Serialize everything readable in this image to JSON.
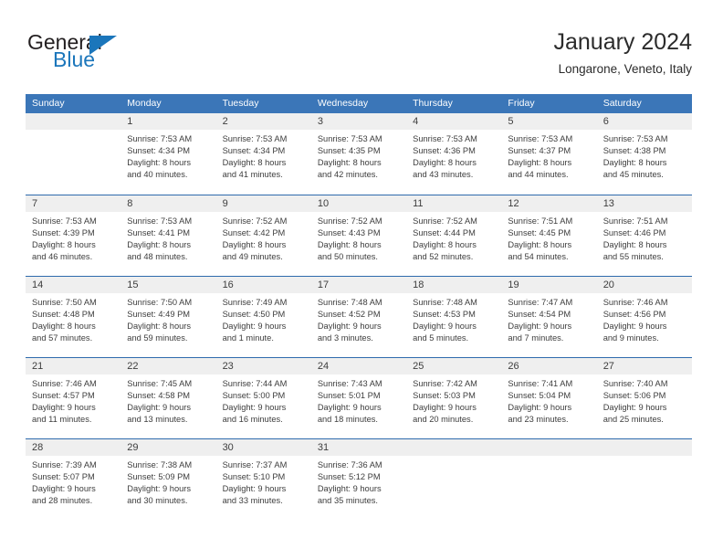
{
  "brand": {
    "name_part1": "General",
    "name_part2": "Blue",
    "accent_color": "#1b76bb"
  },
  "header": {
    "title": "January 2024",
    "subtitle": "Longarone, Veneto, Italy"
  },
  "calendar": {
    "header_color": "#3b76b8",
    "day_band_color": "#efefef",
    "weekdays": [
      "Sunday",
      "Monday",
      "Tuesday",
      "Wednesday",
      "Thursday",
      "Friday",
      "Saturday"
    ],
    "weeks": [
      [
        {
          "day": "",
          "lines": []
        },
        {
          "day": "1",
          "lines": [
            "Sunrise: 7:53 AM",
            "Sunset: 4:34 PM",
            "Daylight: 8 hours",
            "and 40 minutes."
          ]
        },
        {
          "day": "2",
          "lines": [
            "Sunrise: 7:53 AM",
            "Sunset: 4:34 PM",
            "Daylight: 8 hours",
            "and 41 minutes."
          ]
        },
        {
          "day": "3",
          "lines": [
            "Sunrise: 7:53 AM",
            "Sunset: 4:35 PM",
            "Daylight: 8 hours",
            "and 42 minutes."
          ]
        },
        {
          "day": "4",
          "lines": [
            "Sunrise: 7:53 AM",
            "Sunset: 4:36 PM",
            "Daylight: 8 hours",
            "and 43 minutes."
          ]
        },
        {
          "day": "5",
          "lines": [
            "Sunrise: 7:53 AM",
            "Sunset: 4:37 PM",
            "Daylight: 8 hours",
            "and 44 minutes."
          ]
        },
        {
          "day": "6",
          "lines": [
            "Sunrise: 7:53 AM",
            "Sunset: 4:38 PM",
            "Daylight: 8 hours",
            "and 45 minutes."
          ]
        }
      ],
      [
        {
          "day": "7",
          "lines": [
            "Sunrise: 7:53 AM",
            "Sunset: 4:39 PM",
            "Daylight: 8 hours",
            "and 46 minutes."
          ]
        },
        {
          "day": "8",
          "lines": [
            "Sunrise: 7:53 AM",
            "Sunset: 4:41 PM",
            "Daylight: 8 hours",
            "and 48 minutes."
          ]
        },
        {
          "day": "9",
          "lines": [
            "Sunrise: 7:52 AM",
            "Sunset: 4:42 PM",
            "Daylight: 8 hours",
            "and 49 minutes."
          ]
        },
        {
          "day": "10",
          "lines": [
            "Sunrise: 7:52 AM",
            "Sunset: 4:43 PM",
            "Daylight: 8 hours",
            "and 50 minutes."
          ]
        },
        {
          "day": "11",
          "lines": [
            "Sunrise: 7:52 AM",
            "Sunset: 4:44 PM",
            "Daylight: 8 hours",
            "and 52 minutes."
          ]
        },
        {
          "day": "12",
          "lines": [
            "Sunrise: 7:51 AM",
            "Sunset: 4:45 PM",
            "Daylight: 8 hours",
            "and 54 minutes."
          ]
        },
        {
          "day": "13",
          "lines": [
            "Sunrise: 7:51 AM",
            "Sunset: 4:46 PM",
            "Daylight: 8 hours",
            "and 55 minutes."
          ]
        }
      ],
      [
        {
          "day": "14",
          "lines": [
            "Sunrise: 7:50 AM",
            "Sunset: 4:48 PM",
            "Daylight: 8 hours",
            "and 57 minutes."
          ]
        },
        {
          "day": "15",
          "lines": [
            "Sunrise: 7:50 AM",
            "Sunset: 4:49 PM",
            "Daylight: 8 hours",
            "and 59 minutes."
          ]
        },
        {
          "day": "16",
          "lines": [
            "Sunrise: 7:49 AM",
            "Sunset: 4:50 PM",
            "Daylight: 9 hours",
            "and 1 minute."
          ]
        },
        {
          "day": "17",
          "lines": [
            "Sunrise: 7:48 AM",
            "Sunset: 4:52 PM",
            "Daylight: 9 hours",
            "and 3 minutes."
          ]
        },
        {
          "day": "18",
          "lines": [
            "Sunrise: 7:48 AM",
            "Sunset: 4:53 PM",
            "Daylight: 9 hours",
            "and 5 minutes."
          ]
        },
        {
          "day": "19",
          "lines": [
            "Sunrise: 7:47 AM",
            "Sunset: 4:54 PM",
            "Daylight: 9 hours",
            "and 7 minutes."
          ]
        },
        {
          "day": "20",
          "lines": [
            "Sunrise: 7:46 AM",
            "Sunset: 4:56 PM",
            "Daylight: 9 hours",
            "and 9 minutes."
          ]
        }
      ],
      [
        {
          "day": "21",
          "lines": [
            "Sunrise: 7:46 AM",
            "Sunset: 4:57 PM",
            "Daylight: 9 hours",
            "and 11 minutes."
          ]
        },
        {
          "day": "22",
          "lines": [
            "Sunrise: 7:45 AM",
            "Sunset: 4:58 PM",
            "Daylight: 9 hours",
            "and 13 minutes."
          ]
        },
        {
          "day": "23",
          "lines": [
            "Sunrise: 7:44 AM",
            "Sunset: 5:00 PM",
            "Daylight: 9 hours",
            "and 16 minutes."
          ]
        },
        {
          "day": "24",
          "lines": [
            "Sunrise: 7:43 AM",
            "Sunset: 5:01 PM",
            "Daylight: 9 hours",
            "and 18 minutes."
          ]
        },
        {
          "day": "25",
          "lines": [
            "Sunrise: 7:42 AM",
            "Sunset: 5:03 PM",
            "Daylight: 9 hours",
            "and 20 minutes."
          ]
        },
        {
          "day": "26",
          "lines": [
            "Sunrise: 7:41 AM",
            "Sunset: 5:04 PM",
            "Daylight: 9 hours",
            "and 23 minutes."
          ]
        },
        {
          "day": "27",
          "lines": [
            "Sunrise: 7:40 AM",
            "Sunset: 5:06 PM",
            "Daylight: 9 hours",
            "and 25 minutes."
          ]
        }
      ],
      [
        {
          "day": "28",
          "lines": [
            "Sunrise: 7:39 AM",
            "Sunset: 5:07 PM",
            "Daylight: 9 hours",
            "and 28 minutes."
          ]
        },
        {
          "day": "29",
          "lines": [
            "Sunrise: 7:38 AM",
            "Sunset: 5:09 PM",
            "Daylight: 9 hours",
            "and 30 minutes."
          ]
        },
        {
          "day": "30",
          "lines": [
            "Sunrise: 7:37 AM",
            "Sunset: 5:10 PM",
            "Daylight: 9 hours",
            "and 33 minutes."
          ]
        },
        {
          "day": "31",
          "lines": [
            "Sunrise: 7:36 AM",
            "Sunset: 5:12 PM",
            "Daylight: 9 hours",
            "and 35 minutes."
          ]
        },
        {
          "day": "",
          "lines": []
        },
        {
          "day": "",
          "lines": []
        },
        {
          "day": "",
          "lines": []
        }
      ]
    ]
  }
}
